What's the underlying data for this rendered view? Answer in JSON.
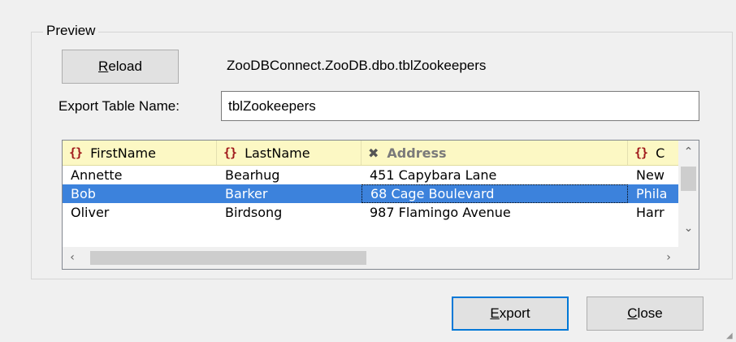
{
  "preview": {
    "group_title": "Preview",
    "reload_button": {
      "mnemonic": "R",
      "rest": "eload"
    },
    "source_path": "ZooDBConnect.ZooDB.dbo.tblZookeepers",
    "export_name_label": "Export Table Name:",
    "export_name_value": "tblZookeepers"
  },
  "grid": {
    "columns": [
      {
        "label": "FirstName",
        "icon": "curly-braces-icon",
        "excluded": false
      },
      {
        "label": "LastName",
        "icon": "curly-braces-icon",
        "excluded": false
      },
      {
        "label": "Address",
        "icon": "excluded-x-icon",
        "excluded": true
      },
      {
        "label": "C",
        "icon": "curly-braces-icon",
        "excluded": false
      }
    ],
    "rows": [
      {
        "first": "Annette",
        "last": "Bearhug",
        "address": "451 Capybara Lane",
        "city": "New"
      },
      {
        "first": "Bob",
        "last": "Barker",
        "address": "68 Cage Boulevard",
        "city": "Phila"
      },
      {
        "first": "Oliver",
        "last": "Birdsong",
        "address": "987 Flamingo Avenue",
        "city": "Harr"
      }
    ],
    "selected_row": 1
  },
  "footer": {
    "export_button": {
      "mnemonic": "E",
      "rest": "xport"
    },
    "close_button": {
      "mnemonic": "C",
      "rest": "lose"
    }
  },
  "colors": {
    "header_bg": "#fcf8c4",
    "selection": "#3c82dc",
    "icon_red": "#a0191b",
    "default_button_border": "#0078d7"
  }
}
